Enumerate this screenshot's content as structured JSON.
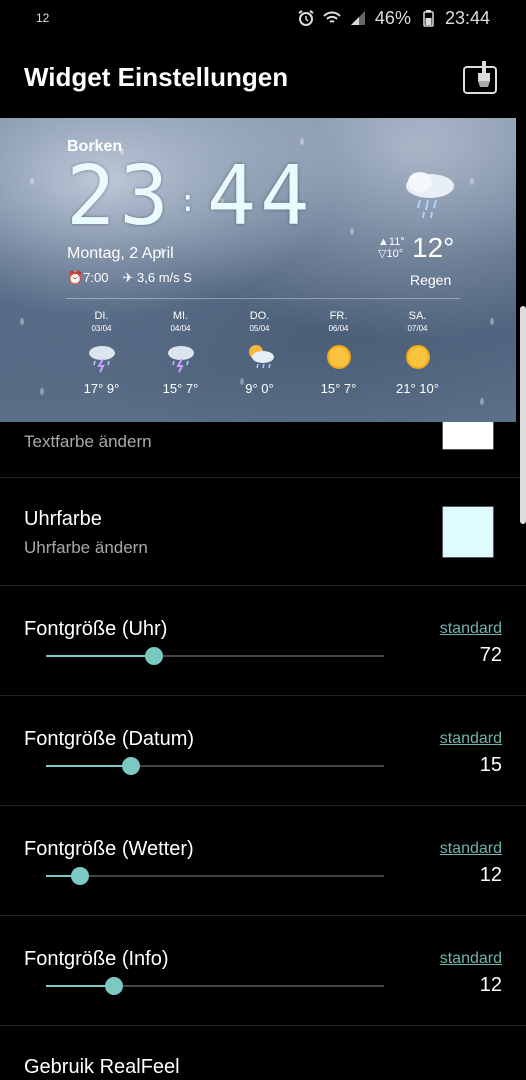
{
  "status": {
    "left": "12",
    "battery": "46%",
    "time": "23:44"
  },
  "header": {
    "title": "Widget Einstellungen"
  },
  "widget": {
    "city": "Borken",
    "clock_hours": "23",
    "clock_minutes": "44",
    "clock_sep": ":",
    "date": "Montag, 2 April",
    "alarm": "7:00",
    "wind": "3,6 m/s S",
    "high": "▲11°",
    "low": "▽10°",
    "temp": "12°",
    "condition": "Regen",
    "forecast": [
      {
        "day": "DI.",
        "date": "03/04",
        "temps": "17° 9°",
        "icon": "storm-cloud-icon"
      },
      {
        "day": "MI.",
        "date": "04/04",
        "temps": "15° 7°",
        "icon": "storm-cloud-icon"
      },
      {
        "day": "DO.",
        "date": "05/04",
        "temps": "9° 0°",
        "icon": "sun-cloud-rain-icon"
      },
      {
        "day": "FR.",
        "date": "06/04",
        "temps": "15° 7°",
        "icon": "sun-icon"
      },
      {
        "day": "SA.",
        "date": "07/04",
        "temps": "21° 10°",
        "icon": "sun-icon"
      }
    ]
  },
  "settings": {
    "textcolor_sub": "Textfarbe ändern",
    "clockcolor_title": "Uhrfarbe",
    "clockcolor_sub": "Uhrfarbe ändern",
    "sliders": [
      {
        "label": "Fontgröße (Uhr)",
        "reset": "standard",
        "value": "72",
        "fraction": 0.32
      },
      {
        "label": "Fontgröße (Datum)",
        "reset": "standard",
        "value": "15",
        "fraction": 0.25
      },
      {
        "label": "Fontgröße (Wetter)",
        "reset": "standard",
        "value": "12",
        "fraction": 0.1
      },
      {
        "label": "Fontgröße (Info)",
        "reset": "standard",
        "value": "12",
        "fraction": 0.2
      }
    ],
    "realfeel_title": "Gebruik RealFeel"
  },
  "colors": {
    "accent": "#7cc8c2",
    "text_color_swatch": "#ffffff",
    "clock_color_swatch": "#e0fbff"
  }
}
